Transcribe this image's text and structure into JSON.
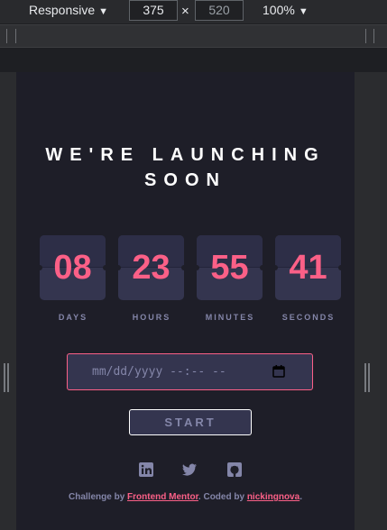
{
  "toolbar": {
    "device": "Responsive",
    "width": "375",
    "times": "×",
    "height": "520",
    "zoom": "100%",
    "caret": "▼"
  },
  "page": {
    "headline_line1": "WE'RE LAUNCHING",
    "headline_line2": "SOON",
    "countdown": [
      {
        "value": "08",
        "label": "DAYS"
      },
      {
        "value": "23",
        "label": "HOURS"
      },
      {
        "value": "55",
        "label": "MINUTES"
      },
      {
        "value": "41",
        "label": "SECONDS"
      }
    ],
    "datetime_placeholder": "mm/dd/yyyy --:-- --",
    "start_label": "START",
    "social_icons": [
      "linkedin-icon",
      "twitter-icon",
      "github-icon"
    ],
    "attribution": {
      "prefix": "Challenge by ",
      "challenge_link": "Frontend Mentor",
      "middle": ". Coded by ",
      "coder_link": "nickingnova",
      "suffix": "."
    }
  },
  "colors": {
    "accent": "#fb6087",
    "muted": "#8486a9",
    "card": "#34354f",
    "background": "#1e1e28"
  }
}
